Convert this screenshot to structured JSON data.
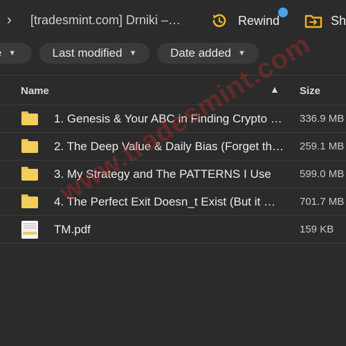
{
  "topbar": {
    "breadcrumb": "[tradesmint.com] Drniki –…",
    "rewind_label": "Rewind",
    "share_label": "Sha",
    "chevron_icon": "chevron-right-icon",
    "rewind_icon": "rewind-clock-icon",
    "share_icon": "shared-folder-icon"
  },
  "filters": {
    "type_label": "e",
    "modified_label": "Last modified",
    "added_label": "Date added"
  },
  "table": {
    "columns": {
      "name": "Name",
      "size": "Size"
    },
    "rows": [
      {
        "name": "1. Genesis & Your ABC in Finding Crypto …",
        "size": "336.9 MB",
        "kind": "folder"
      },
      {
        "name": "2. The Deep Value & Daily Bias (Forget th…",
        "size": "259.1 MB",
        "kind": "folder"
      },
      {
        "name": "3. My Strategy and The PATTERNS I Use",
        "size": "599.0 MB",
        "kind": "folder"
      },
      {
        "name": "4. The Perfect Exit Doesn_t Exist (But it …",
        "size": "701.7 MB",
        "kind": "folder"
      },
      {
        "name": "TM.pdf",
        "size": "159 KB",
        "kind": "pdf"
      }
    ]
  },
  "watermark": "www.tradesmint.com",
  "colors": {
    "background": "#2b2b2b",
    "folder": "#f2cf5b",
    "rewind_accent": "#f5b324",
    "notification_dot": "#4aa3e8",
    "watermark": "#c82828"
  }
}
